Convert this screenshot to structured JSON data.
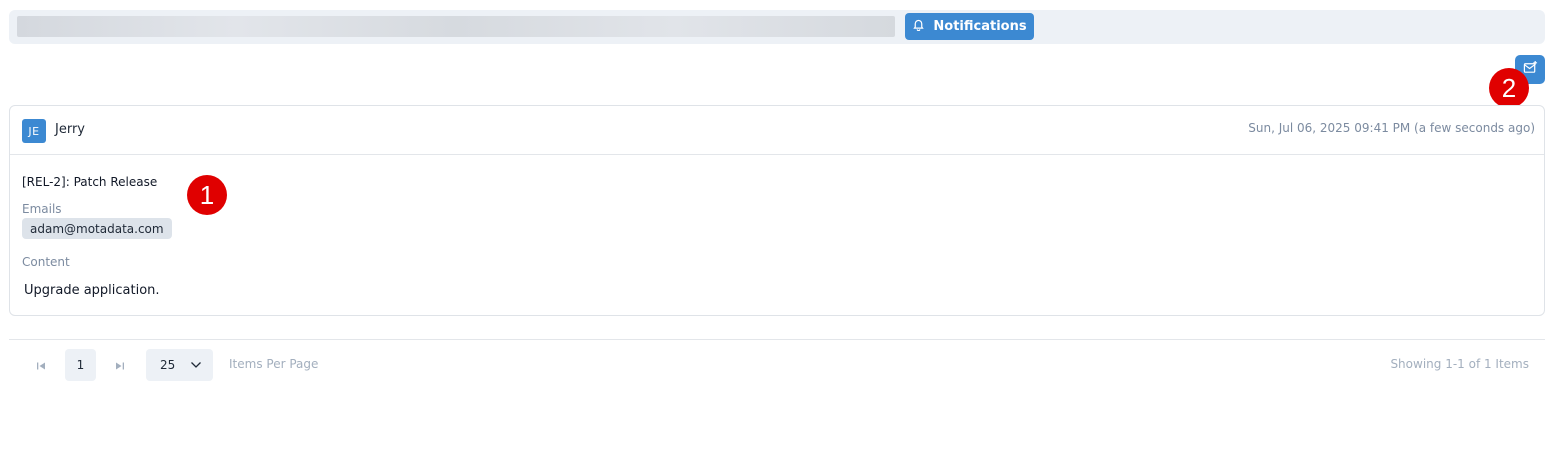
{
  "top_tabs": {
    "active_tab_label": "Notifications",
    "active_tab_icon": "bell-icon"
  },
  "actions": {
    "compose_icon": "compose-email-icon"
  },
  "markers": {
    "one": "1",
    "two": "2"
  },
  "notification": {
    "avatar_initials": "JE",
    "user_name": "Jerry",
    "timestamp": "Sun, Jul 06, 2025 09:41 PM (a few seconds ago)",
    "subject": "[REL-2]: Patch Release",
    "emails_label": "Emails",
    "emails": [
      "adam@motadata.com"
    ],
    "content_label": "Content",
    "content": "Upgrade application."
  },
  "pagination": {
    "current_page": "1",
    "per_page_value": "25",
    "per_page_label": "Items Per Page",
    "showing_text": "Showing 1-1 of 1 Items"
  },
  "colors": {
    "accent": "#3c89d2",
    "marker": "#e00000",
    "muted_text": "#7c8ba0"
  }
}
